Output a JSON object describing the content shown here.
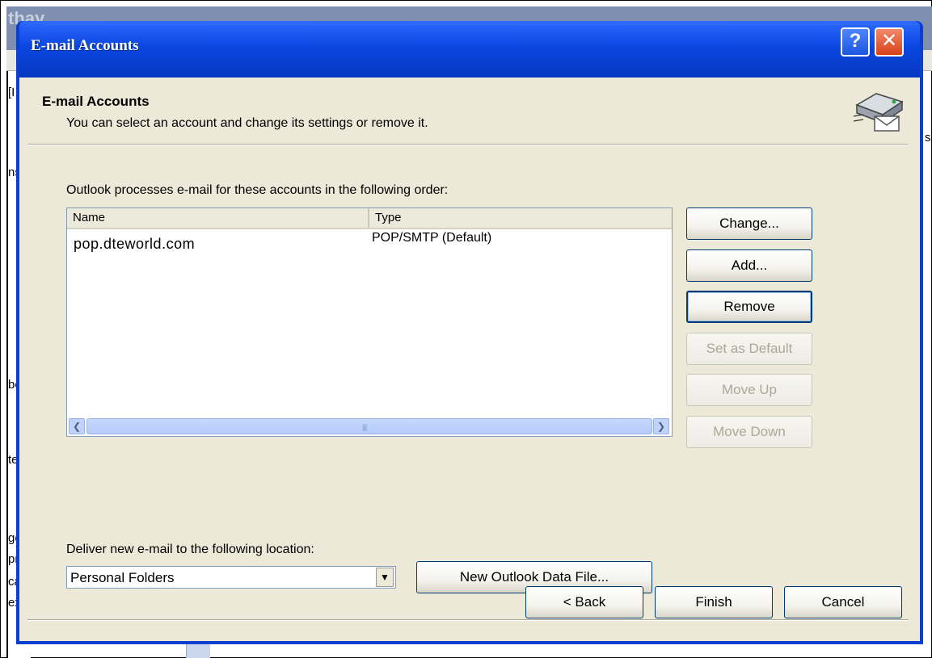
{
  "background": {
    "title_fragment": "thay",
    "left_fragments": [
      "[I",
      "ns",
      "bo",
      "te",
      "ge",
      "pr",
      "ca",
      "ex"
    ],
    "right_fragment": "s"
  },
  "dialog": {
    "title": "E-mail Accounts",
    "help_label": "?",
    "close_label": "✕"
  },
  "header": {
    "title": "E-mail Accounts",
    "subtitle": "You can select an account and change its settings or remove it."
  },
  "accounts": {
    "label": "Outlook processes e-mail for these accounts in the following order:",
    "columns": [
      "Name",
      "Type"
    ],
    "rows": [
      {
        "name": "pop.dteworld.com",
        "type": "POP/SMTP (Default)"
      }
    ]
  },
  "side_buttons": {
    "change": "Change...",
    "add": "Add...",
    "remove": "Remove",
    "set_default": "Set as Default",
    "move_up": "Move Up",
    "move_down": "Move Down"
  },
  "delivery": {
    "label": "Deliver new e-mail to the following location:",
    "location": "Personal Folders",
    "new_data_file_button": "New Outlook Data File..."
  },
  "footer": {
    "back": "< Back",
    "finish": "Finish",
    "cancel": "Cancel"
  },
  "icons": {
    "header": "mail-server-envelope-icon",
    "scroll_left": "arrow-left-icon",
    "scroll_right": "arrow-right-icon",
    "combo": "chevron-down-icon"
  },
  "colors": {
    "titlebar": "#0a46e0",
    "dialog_bg": "#ece9d8",
    "button_border": "#003c74",
    "disabled_text": "#aca899"
  }
}
